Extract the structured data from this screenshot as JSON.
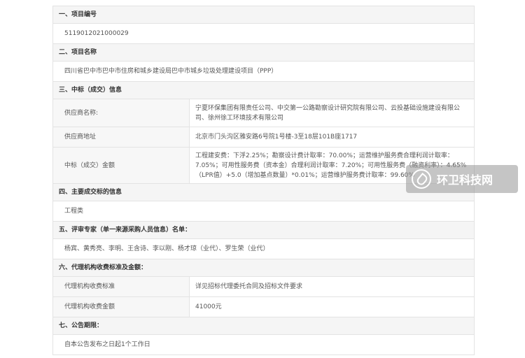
{
  "sections": {
    "s1": {
      "title": "一、项目编号",
      "value": "5119012021000029"
    },
    "s2": {
      "title": "二、项目名称",
      "value": "四川省巴中市巴中市住房和城乡建设局巴中市城乡垃圾处理建设项目（PPP）"
    },
    "s3": {
      "title": "三、中标（成交）信息",
      "supplier_name_label": "供应商名称:",
      "supplier_name": "宁夏环保集团有限责任公司、中交第一公路勘察设计研究院有限公司、云投基础设施建设有限公司、徐州徐工环境技术有限公司",
      "supplier_address_label": "供应商地址",
      "supplier_address": "北京市门头沟区雅安路6号院1号楼-3至18层101B座1717",
      "amount_label": "中标（成交）金额",
      "amount": "工程建安费：下浮2.25%；勘察设计费计取率：70.00%；运营维护服务费合理利润计取率：7.05%；可用性服务费（资本金）合理利润计取率：7.20%；可用性服务费（融资利率）：4.65%（LPR值）+5.0（增加基点数量）*0.01%；运营维护服务费计取率：99.60%"
    },
    "s4": {
      "title": "四、主要成交标的信息",
      "value": "工程类"
    },
    "s5": {
      "title": "五、评审专家（单一来源采购人员信息）名单：",
      "value": "杨宾、黄秀亮、李明、王含诗、李以刚、杨才琼（业代）、罗生荣（业代）"
    },
    "s6": {
      "title": "六、代理机构收费标准及金额：",
      "standard_label": "代理机构收费标准",
      "standard": "详见招标代理委托合同及招标文件要求",
      "fee_label": "代理机构收费金额",
      "fee": "41000元"
    },
    "s7": {
      "title": "七、公告期限：",
      "value": "自本公告发布之日起1个工作日"
    }
  },
  "watermark": {
    "text": "环卫科技网",
    "icon": "leaf-logo-icon"
  }
}
